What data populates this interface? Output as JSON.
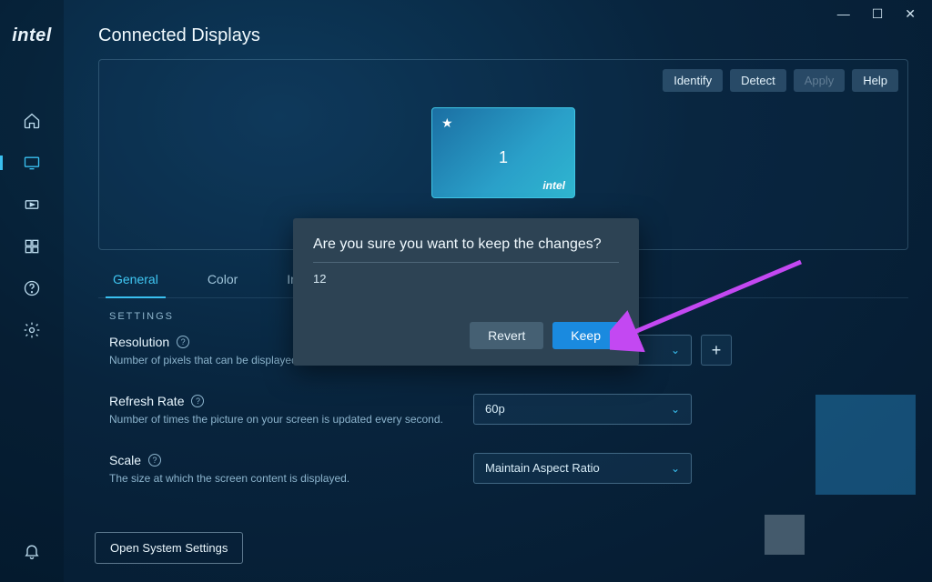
{
  "brand": "intel",
  "window": {
    "page_title": "Connected Displays"
  },
  "panel_buttons": {
    "identify": "Identify",
    "detect": "Detect",
    "apply": "Apply",
    "help": "Help"
  },
  "display_tile": {
    "number": "1",
    "brand": "intel"
  },
  "tabs": {
    "general": "General",
    "color": "Color",
    "image_partial": "In"
  },
  "settings_label": "SETTINGS",
  "rows": {
    "resolution": {
      "name": "Resolution",
      "desc": "Number of pixels that can be displayed"
    },
    "refresh": {
      "name": "Refresh Rate",
      "desc": "Number of times the picture on your screen is updated every second.",
      "value": "60p"
    },
    "scale": {
      "name": "Scale",
      "desc": "The size at which the screen content is displayed.",
      "value": "Maintain Aspect Ratio"
    }
  },
  "open_sys": "Open System Settings",
  "modal": {
    "title": "Are you sure you want to keep the changes?",
    "countdown": "12",
    "revert": "Revert",
    "keep": "Keep"
  }
}
